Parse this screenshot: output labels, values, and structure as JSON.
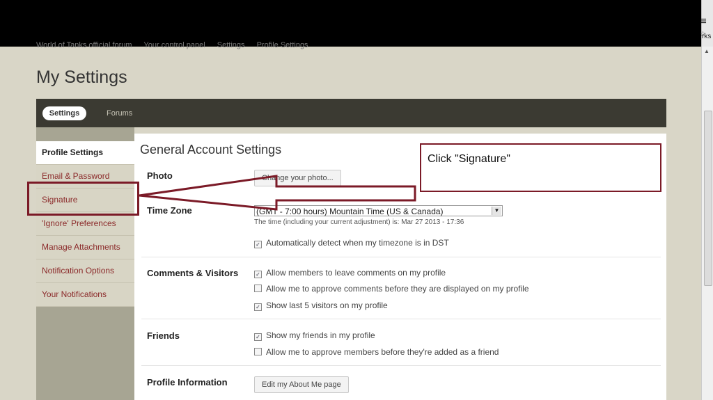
{
  "browser": {
    "menu_icon": "hamburger-menu-icon",
    "bookmarks_fragment": "rks"
  },
  "breadcrumb": [
    "World of Tanks official forum",
    "Your control panel",
    "Settings",
    "Profile Settings"
  ],
  "page_title": "My Settings",
  "tabs": [
    {
      "label": "Settings",
      "active": true
    },
    {
      "label": "Forums",
      "active": false
    }
  ],
  "sidebar": {
    "items": [
      {
        "label": "Profile Settings",
        "active": true
      },
      {
        "label": "Email & Password"
      },
      {
        "label": "Signature"
      },
      {
        "label": "'Ignore' Preferences"
      },
      {
        "label": "Manage Attachments"
      },
      {
        "label": "Notification Options"
      },
      {
        "label": "Your Notifications"
      }
    ]
  },
  "content": {
    "title": "General Account Settings",
    "photo": {
      "label": "Photo",
      "button": "Change your photo..."
    },
    "timezone": {
      "label": "Time Zone",
      "selected": "(GMT - 7:00 hours) Mountain Time (US & Canada)",
      "note": "The time (including your current adjustment) is: Mar 27 2013 - 17:36",
      "dst": {
        "label": "Automatically detect when my timezone is in DST",
        "checked": true
      }
    },
    "comments": {
      "label": "Comments & Visitors",
      "options": [
        {
          "label": "Allow members to leave comments on my profile",
          "checked": true
        },
        {
          "label": "Allow me to approve comments before they are displayed on my profile",
          "checked": false
        },
        {
          "label": "Show last 5 visitors on my profile",
          "checked": true
        }
      ]
    },
    "friends": {
      "label": "Friends",
      "options": [
        {
          "label": "Show my friends in my profile",
          "checked": true
        },
        {
          "label": "Allow me to approve members before they're added as a friend",
          "checked": false
        }
      ]
    },
    "profile_info": {
      "label": "Profile Information",
      "button": "Edit my About Me page"
    }
  },
  "annotation": {
    "callout": "Click \"Signature\"",
    "color": "#7b1a27"
  }
}
